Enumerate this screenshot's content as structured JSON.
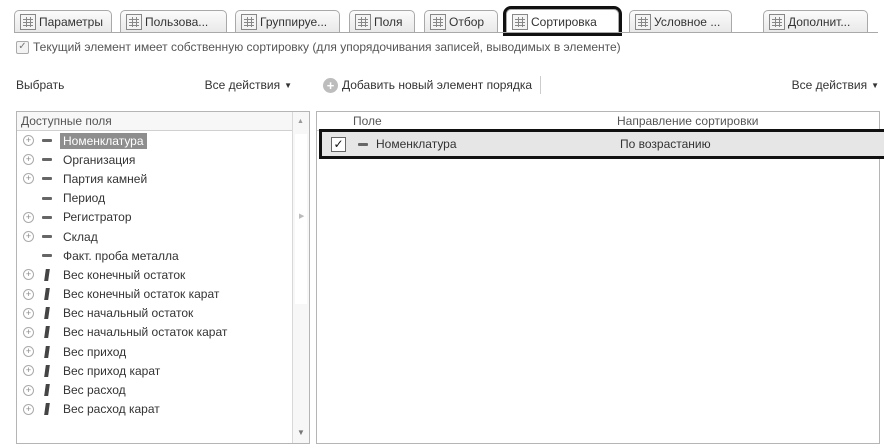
{
  "tabs": [
    {
      "label": "Параметры",
      "icon": "table-icon"
    },
    {
      "label": "Пользова...",
      "icon": "table-icon"
    },
    {
      "label": "Группируе...",
      "icon": "table-icon"
    },
    {
      "label": "Поля",
      "icon": "list-icon"
    },
    {
      "label": "Отбор",
      "icon": "filter-icon"
    },
    {
      "label": "Сортировка",
      "icon": "sort-icon",
      "active": true
    },
    {
      "label": "Условное ...",
      "icon": "brush-icon"
    },
    {
      "label": "Дополнит...",
      "icon": "settings-icon"
    }
  ],
  "own_sort": {
    "checked": true,
    "label": "Текущий элемент имеет собственную сортировку (для  упорядочивания записей, выводимых в элементе)"
  },
  "left_toolbar": {
    "select_label": "Выбрать",
    "actions_label": "Все действия"
  },
  "right_toolbar": {
    "add_label": "Добавить новый элемент порядка",
    "actions_label": "Все действия"
  },
  "available_fields": {
    "header": "Доступные поля",
    "items": [
      {
        "label": "Номенклатура",
        "expandable": true,
        "kind": "attribute",
        "selected": true
      },
      {
        "label": "Организация",
        "expandable": true,
        "kind": "attribute"
      },
      {
        "label": "Партия камней",
        "expandable": true,
        "kind": "attribute"
      },
      {
        "label": "Период",
        "expandable": false,
        "kind": "attribute"
      },
      {
        "label": "Регистратор",
        "expandable": true,
        "kind": "attribute"
      },
      {
        "label": "Склад",
        "expandable": true,
        "kind": "attribute"
      },
      {
        "label": "Факт. проба металла",
        "expandable": false,
        "kind": "attribute"
      },
      {
        "label": "Вес конечный остаток",
        "expandable": true,
        "kind": "resource"
      },
      {
        "label": "Вес конечный остаток карат",
        "expandable": true,
        "kind": "resource"
      },
      {
        "label": "Вес начальный остаток",
        "expandable": true,
        "kind": "resource"
      },
      {
        "label": "Вес начальный остаток карат",
        "expandable": true,
        "kind": "resource"
      },
      {
        "label": "Вес приход",
        "expandable": true,
        "kind": "resource"
      },
      {
        "label": "Вес приход карат",
        "expandable": true,
        "kind": "resource"
      },
      {
        "label": "Вес расход",
        "expandable": true,
        "kind": "resource"
      },
      {
        "label": "Вес расход карат",
        "expandable": true,
        "kind": "resource"
      }
    ]
  },
  "sort_table": {
    "columns": {
      "field": "Поле",
      "direction": "Направление сортировки"
    },
    "rows": [
      {
        "checked": true,
        "field": "Номенклатура",
        "direction": "По возрастанию"
      }
    ]
  }
}
